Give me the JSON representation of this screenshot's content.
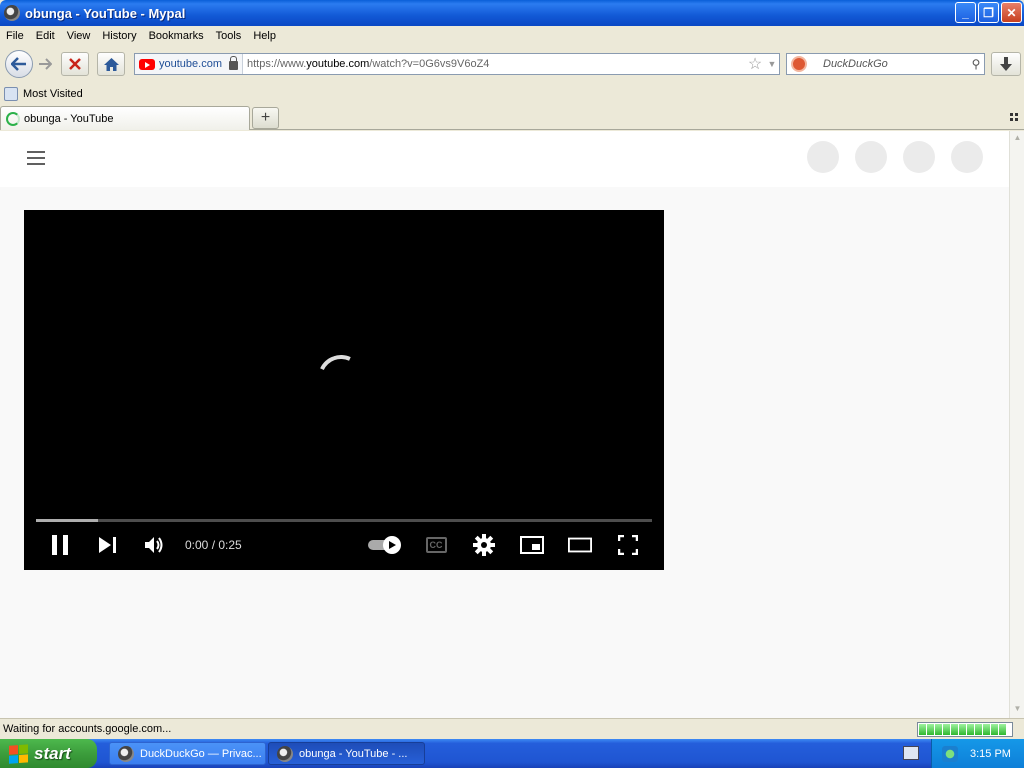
{
  "window": {
    "title": "obunga - YouTube - Mypal",
    "minimize": "_",
    "maximize": "❐",
    "close": "✕"
  },
  "menu": {
    "items": [
      "File",
      "Edit",
      "View",
      "History",
      "Bookmarks",
      "Tools",
      "Help"
    ]
  },
  "nav": {
    "identity_domain": "youtube.com",
    "url_prefix": "https://www.",
    "url_host": "youtube.com",
    "url_path": "/watch?v=0G6vs9V6oZ4",
    "search_placeholder": "DuckDuckGo"
  },
  "bookmarks": {
    "most_visited": "Most Visited"
  },
  "tabs": {
    "active_label": "obunga - YouTube",
    "new_tab": "+"
  },
  "player": {
    "time": "0:00 / 0:25",
    "progress_buffered": 0.1,
    "cc_label": "CC"
  },
  "status": {
    "text": "Waiting for accounts.google.com...",
    "load_segments": 11
  },
  "taskbar": {
    "start_label": "start",
    "tasks": [
      {
        "label": "DuckDuckGo — Privac...",
        "active": false
      },
      {
        "label": "obunga - YouTube - ...",
        "active": true
      }
    ],
    "clock": "3:15 PM"
  },
  "colors": {
    "youtube_red": "#ff0000",
    "xp_blue": "#245edb",
    "start_green": "#3c9d3c"
  }
}
